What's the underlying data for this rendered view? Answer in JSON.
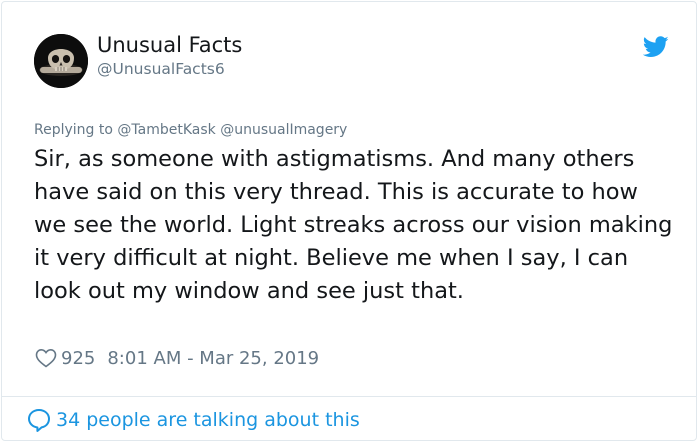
{
  "colors": {
    "text": "#14171a",
    "secondary": "#657786",
    "accent": "#1b95e0",
    "twitter_blue": "#1da1f2",
    "border": "#e1e8ed"
  },
  "author": {
    "display_name": "Unusual Facts",
    "handle": "@UnusualFacts6",
    "avatar_icon": "skull-avatar"
  },
  "reply": {
    "prefix": "Replying to ",
    "mentions": [
      "@TambetKask",
      "@unusualImagery"
    ]
  },
  "tweet": {
    "text": "Sir, as someone with astigmatisms. And many others have said on this very thread. This is accurate to how we see the world. Light streaks across our vision making it very difficult at night. Believe me when I say, I can look out my window and see just that."
  },
  "meta": {
    "likes": "925",
    "timestamp": "8:01 AM - Mar 25, 2019"
  },
  "footer": {
    "talking": "34 people are talking about this"
  },
  "icons": [
    "twitter-bird-icon",
    "heart-icon",
    "speech-bubble-icon"
  ]
}
